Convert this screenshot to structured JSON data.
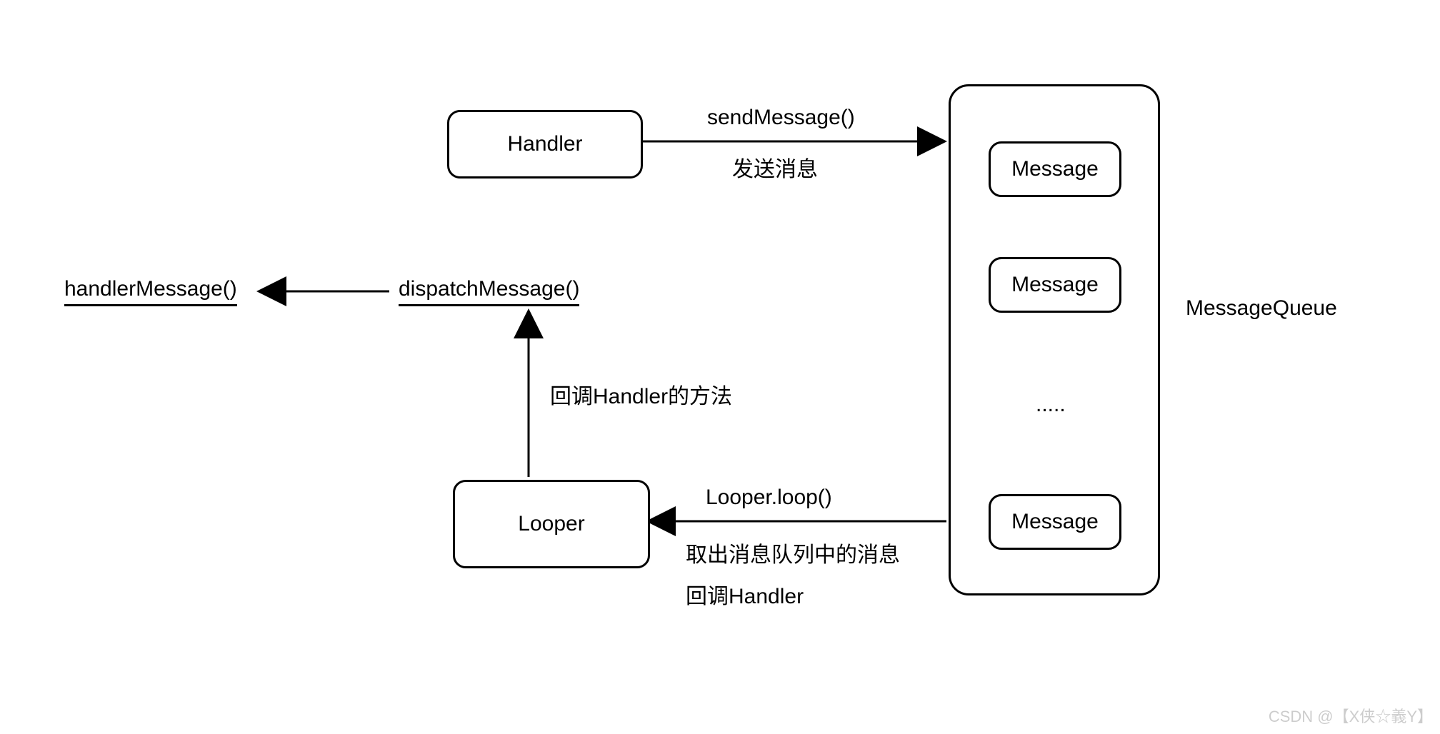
{
  "boxes": {
    "handler": "Handler",
    "looper": "Looper",
    "message1": "Message",
    "message2": "Message",
    "message3": "Message"
  },
  "underlined": {
    "handlerMessage": "handlerMessage()",
    "dispatchMessage": "dispatchMessage()"
  },
  "labels": {
    "sendMessage": "sendMessage()",
    "sendMessageCn": "发送消息",
    "messageQueue": "MessageQueue",
    "ellipsis": ".....",
    "callbackHandlerMethod": "回调Handler的方法",
    "looperLoop": "Looper.loop()",
    "dequeueCn": "取出消息队列中的消息",
    "callbackHandler": "回调Handler"
  },
  "watermark": "CSDN @【X侠☆義Y】"
}
